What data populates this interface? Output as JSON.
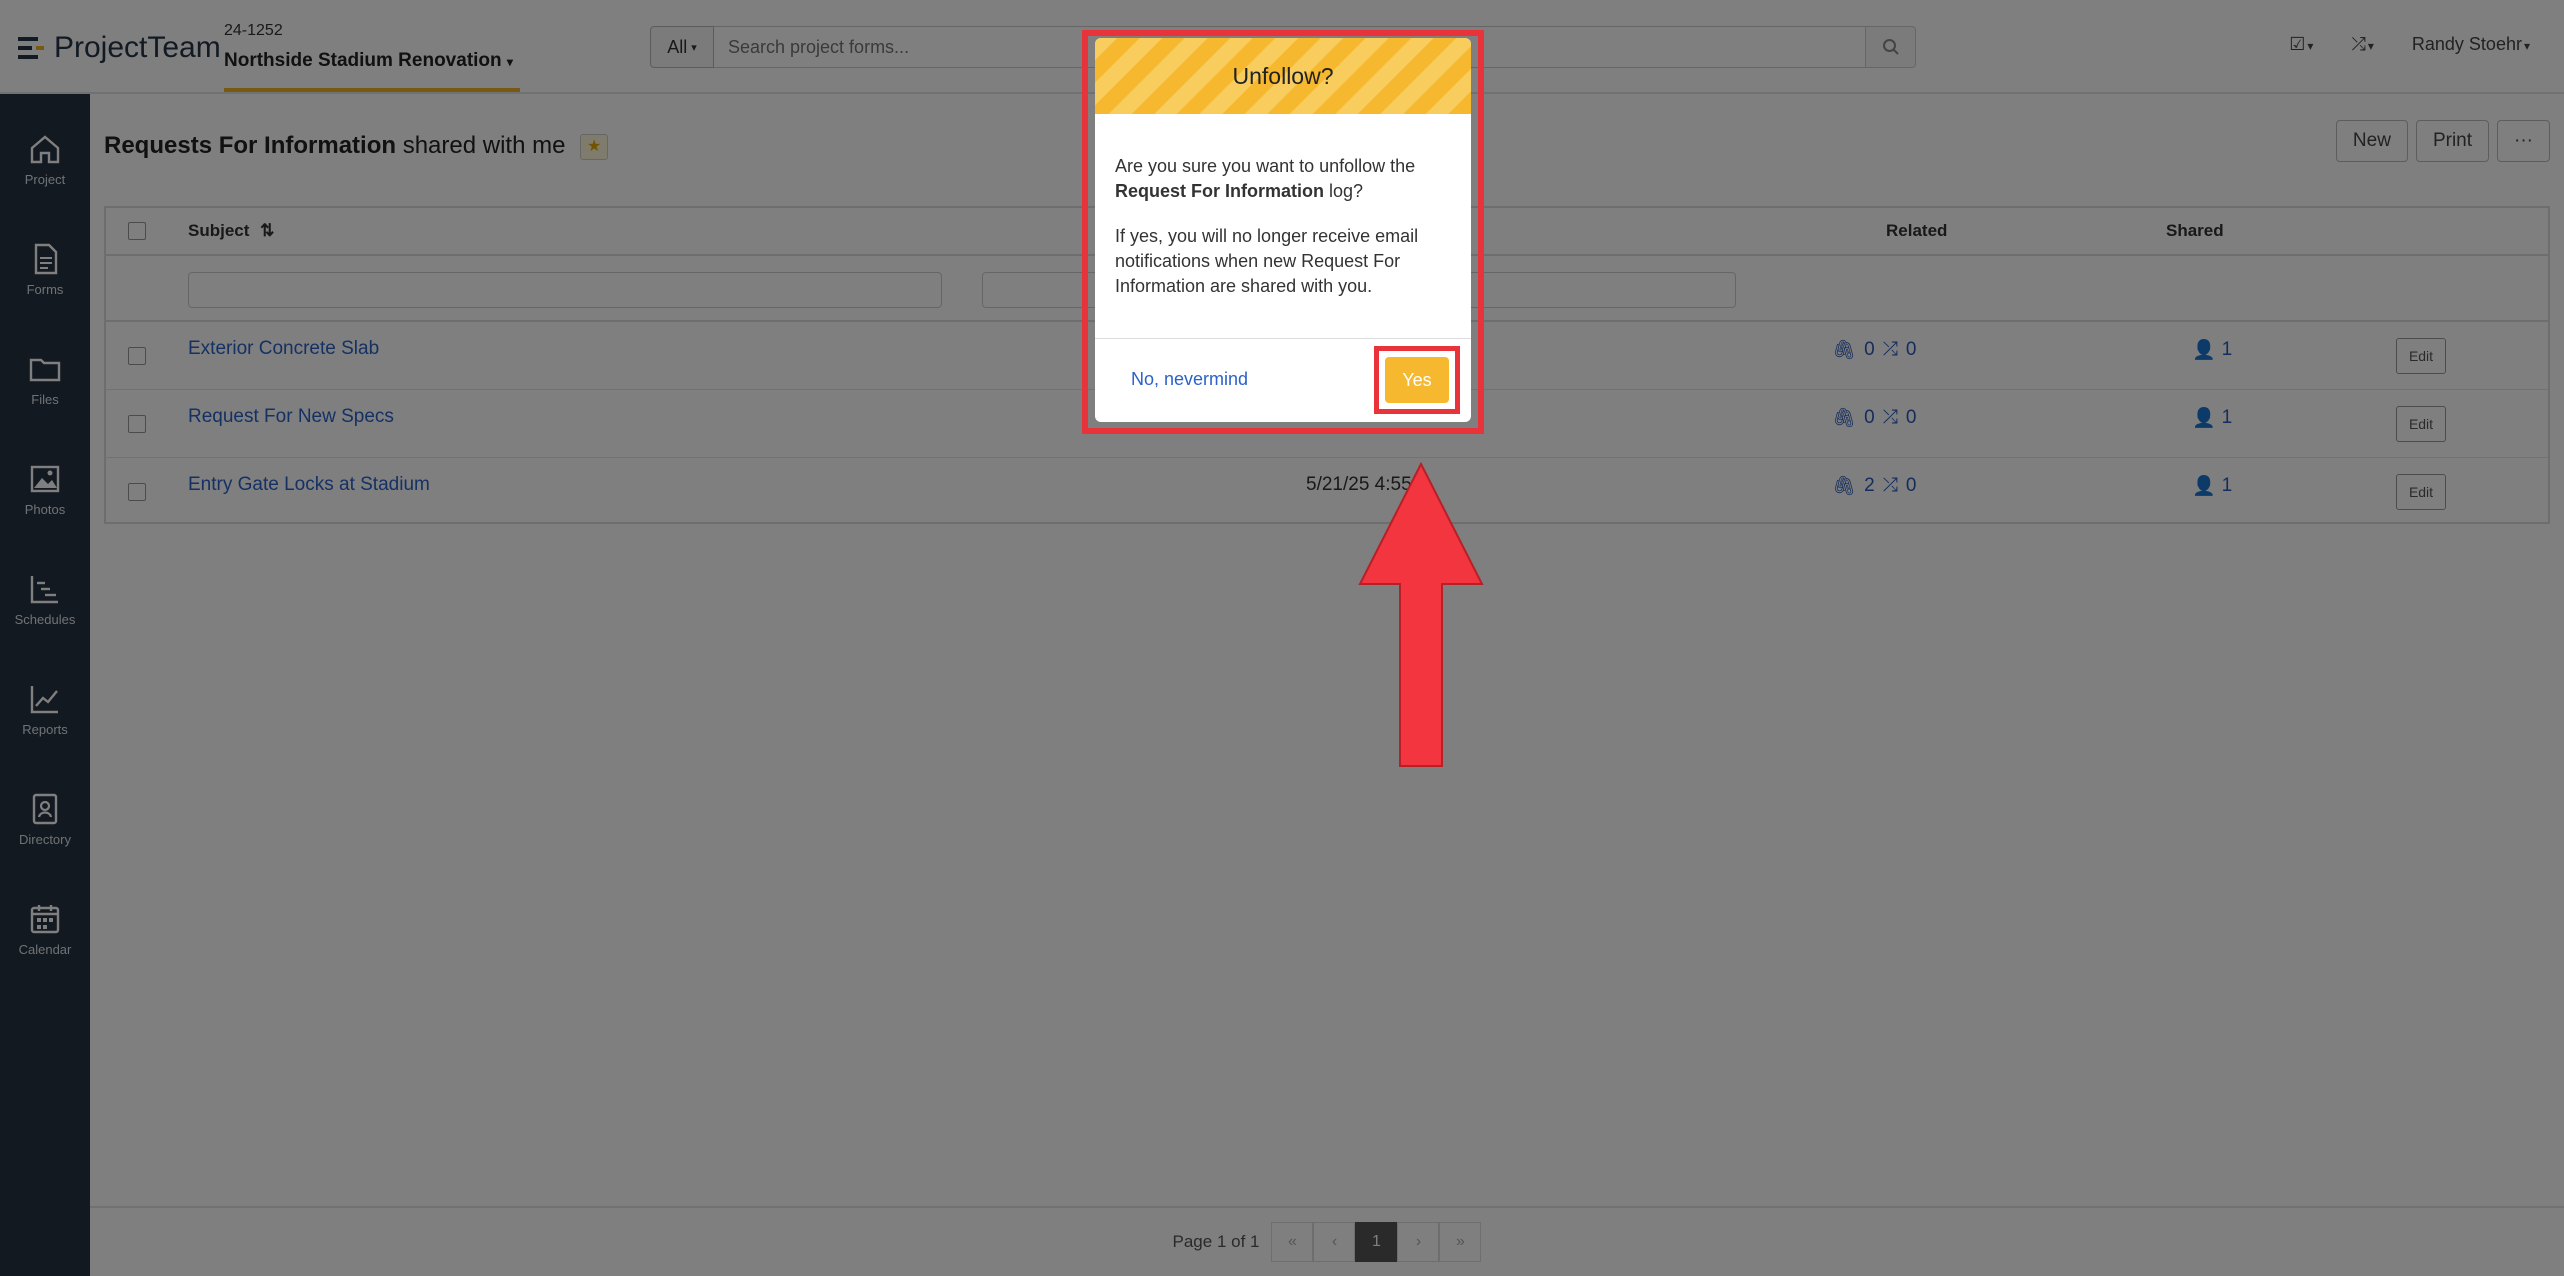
{
  "app": {
    "logo_text": "ProjectTeam"
  },
  "project": {
    "number": "24-1252",
    "name": "Northside Stadium Renovation"
  },
  "search": {
    "scope_label": "All",
    "placeholder": "Search project forms..."
  },
  "user": {
    "name": "Randy Stoehr"
  },
  "sidebar": {
    "items": [
      {
        "label": "Project",
        "icon": "home-icon"
      },
      {
        "label": "Forms",
        "icon": "document-icon"
      },
      {
        "label": "Files",
        "icon": "folder-icon"
      },
      {
        "label": "Photos",
        "icon": "image-icon"
      },
      {
        "label": "Schedules",
        "icon": "gantt-icon"
      },
      {
        "label": "Reports",
        "icon": "line-chart-icon"
      },
      {
        "label": "Directory",
        "icon": "contact-card-icon"
      },
      {
        "label": "Calendar",
        "icon": "calendar-icon"
      }
    ]
  },
  "page": {
    "title_bold": "Requests For Information",
    "title_rest": "shared with me",
    "buttons": {
      "new": "New",
      "print": "Print",
      "more": "···"
    }
  },
  "table": {
    "headers": {
      "subject": "Subject",
      "related": "Related",
      "shared": "Shared"
    },
    "rows": [
      {
        "subject": "Exterior Concrete Slab",
        "date": "",
        "attachments": "0",
        "links": "0",
        "shared": "1",
        "edit": "Edit"
      },
      {
        "subject": "Request For New Specs",
        "date": "",
        "attachments": "0",
        "links": "0",
        "shared": "1",
        "edit": "Edit"
      },
      {
        "subject": "Entry Gate Locks at Stadium",
        "date": "5/21/25 4:55 P",
        "attachments": "2",
        "links": "0",
        "shared": "1",
        "edit": "Edit"
      }
    ]
  },
  "pager": {
    "label": "Page 1 of 1",
    "current": "1"
  },
  "modal": {
    "title": "Unfollow?",
    "line1_pre": "Are you sure you want to unfollow the ",
    "line1_bold": "Request For Information",
    "line1_post": " log?",
    "line2": "If yes, you will no longer receive email notifications when new Request For Information are shared with you.",
    "cancel": "No, nevermind",
    "confirm": "Yes"
  },
  "colors": {
    "accent": "#f5b82e",
    "annotation": "#e8333a",
    "link": "#2a62c9",
    "sidebar": "#263240"
  }
}
